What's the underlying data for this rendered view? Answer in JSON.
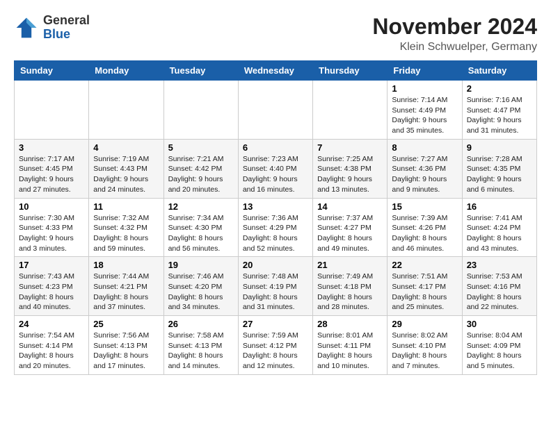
{
  "logo": {
    "general": "General",
    "blue": "Blue"
  },
  "title": "November 2024",
  "location": "Klein Schwuelper, Germany",
  "days_of_week": [
    "Sunday",
    "Monday",
    "Tuesday",
    "Wednesday",
    "Thursday",
    "Friday",
    "Saturday"
  ],
  "weeks": [
    [
      {
        "day": "",
        "detail": ""
      },
      {
        "day": "",
        "detail": ""
      },
      {
        "day": "",
        "detail": ""
      },
      {
        "day": "",
        "detail": ""
      },
      {
        "day": "",
        "detail": ""
      },
      {
        "day": "1",
        "detail": "Sunrise: 7:14 AM\nSunset: 4:49 PM\nDaylight: 9 hours\nand 35 minutes."
      },
      {
        "day": "2",
        "detail": "Sunrise: 7:16 AM\nSunset: 4:47 PM\nDaylight: 9 hours\nand 31 minutes."
      }
    ],
    [
      {
        "day": "3",
        "detail": "Sunrise: 7:17 AM\nSunset: 4:45 PM\nDaylight: 9 hours\nand 27 minutes."
      },
      {
        "day": "4",
        "detail": "Sunrise: 7:19 AM\nSunset: 4:43 PM\nDaylight: 9 hours\nand 24 minutes."
      },
      {
        "day": "5",
        "detail": "Sunrise: 7:21 AM\nSunset: 4:42 PM\nDaylight: 9 hours\nand 20 minutes."
      },
      {
        "day": "6",
        "detail": "Sunrise: 7:23 AM\nSunset: 4:40 PM\nDaylight: 9 hours\nand 16 minutes."
      },
      {
        "day": "7",
        "detail": "Sunrise: 7:25 AM\nSunset: 4:38 PM\nDaylight: 9 hours\nand 13 minutes."
      },
      {
        "day": "8",
        "detail": "Sunrise: 7:27 AM\nSunset: 4:36 PM\nDaylight: 9 hours\nand 9 minutes."
      },
      {
        "day": "9",
        "detail": "Sunrise: 7:28 AM\nSunset: 4:35 PM\nDaylight: 9 hours\nand 6 minutes."
      }
    ],
    [
      {
        "day": "10",
        "detail": "Sunrise: 7:30 AM\nSunset: 4:33 PM\nDaylight: 9 hours\nand 3 minutes."
      },
      {
        "day": "11",
        "detail": "Sunrise: 7:32 AM\nSunset: 4:32 PM\nDaylight: 8 hours\nand 59 minutes."
      },
      {
        "day": "12",
        "detail": "Sunrise: 7:34 AM\nSunset: 4:30 PM\nDaylight: 8 hours\nand 56 minutes."
      },
      {
        "day": "13",
        "detail": "Sunrise: 7:36 AM\nSunset: 4:29 PM\nDaylight: 8 hours\nand 52 minutes."
      },
      {
        "day": "14",
        "detail": "Sunrise: 7:37 AM\nSunset: 4:27 PM\nDaylight: 8 hours\nand 49 minutes."
      },
      {
        "day": "15",
        "detail": "Sunrise: 7:39 AM\nSunset: 4:26 PM\nDaylight: 8 hours\nand 46 minutes."
      },
      {
        "day": "16",
        "detail": "Sunrise: 7:41 AM\nSunset: 4:24 PM\nDaylight: 8 hours\nand 43 minutes."
      }
    ],
    [
      {
        "day": "17",
        "detail": "Sunrise: 7:43 AM\nSunset: 4:23 PM\nDaylight: 8 hours\nand 40 minutes."
      },
      {
        "day": "18",
        "detail": "Sunrise: 7:44 AM\nSunset: 4:21 PM\nDaylight: 8 hours\nand 37 minutes."
      },
      {
        "day": "19",
        "detail": "Sunrise: 7:46 AM\nSunset: 4:20 PM\nDaylight: 8 hours\nand 34 minutes."
      },
      {
        "day": "20",
        "detail": "Sunrise: 7:48 AM\nSunset: 4:19 PM\nDaylight: 8 hours\nand 31 minutes."
      },
      {
        "day": "21",
        "detail": "Sunrise: 7:49 AM\nSunset: 4:18 PM\nDaylight: 8 hours\nand 28 minutes."
      },
      {
        "day": "22",
        "detail": "Sunrise: 7:51 AM\nSunset: 4:17 PM\nDaylight: 8 hours\nand 25 minutes."
      },
      {
        "day": "23",
        "detail": "Sunrise: 7:53 AM\nSunset: 4:16 PM\nDaylight: 8 hours\nand 22 minutes."
      }
    ],
    [
      {
        "day": "24",
        "detail": "Sunrise: 7:54 AM\nSunset: 4:14 PM\nDaylight: 8 hours\nand 20 minutes."
      },
      {
        "day": "25",
        "detail": "Sunrise: 7:56 AM\nSunset: 4:13 PM\nDaylight: 8 hours\nand 17 minutes."
      },
      {
        "day": "26",
        "detail": "Sunrise: 7:58 AM\nSunset: 4:13 PM\nDaylight: 8 hours\nand 14 minutes."
      },
      {
        "day": "27",
        "detail": "Sunrise: 7:59 AM\nSunset: 4:12 PM\nDaylight: 8 hours\nand 12 minutes."
      },
      {
        "day": "28",
        "detail": "Sunrise: 8:01 AM\nSunset: 4:11 PM\nDaylight: 8 hours\nand 10 minutes."
      },
      {
        "day": "29",
        "detail": "Sunrise: 8:02 AM\nSunset: 4:10 PM\nDaylight: 8 hours\nand 7 minutes."
      },
      {
        "day": "30",
        "detail": "Sunrise: 8:04 AM\nSunset: 4:09 PM\nDaylight: 8 hours\nand 5 minutes."
      }
    ]
  ]
}
